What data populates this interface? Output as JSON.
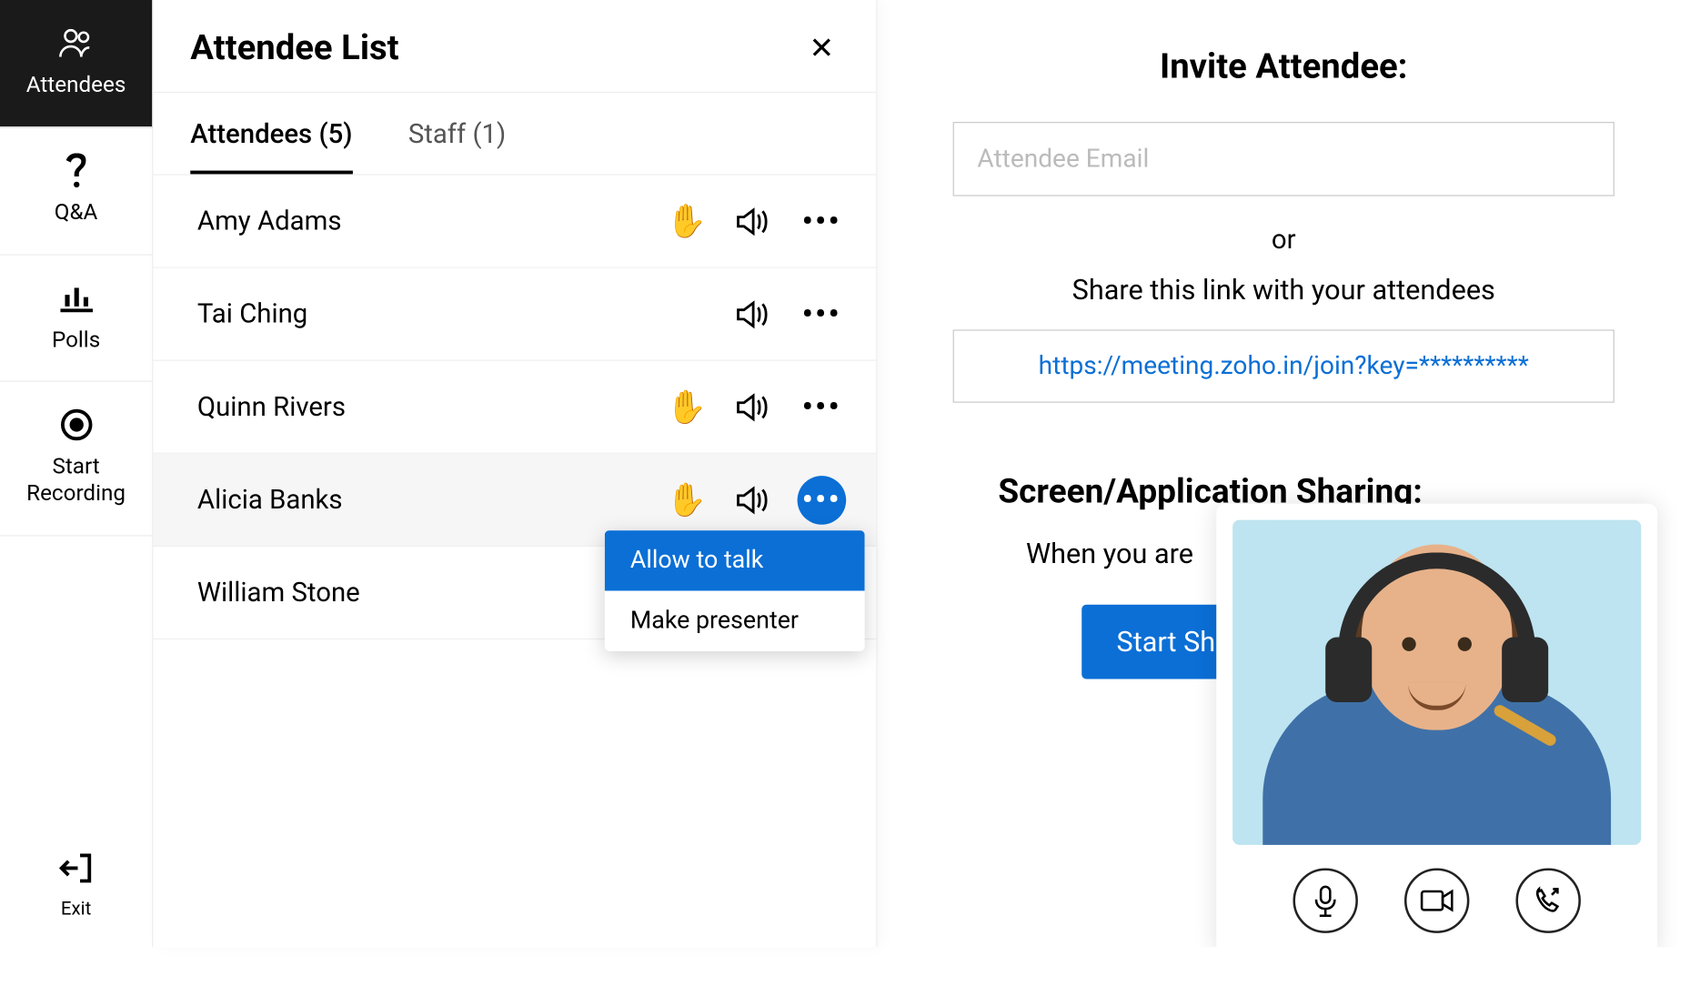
{
  "sidebar": {
    "attendees_label": "Attendees",
    "qa_label": "Q&A",
    "polls_label": "Polls",
    "recording_label": "Start Recording",
    "exit_label": "Exit"
  },
  "panel": {
    "title": "Attendee List",
    "tabs": {
      "attendees_label": "Attendees (5)",
      "staff_label": "Staff (1)"
    },
    "attendees": [
      {
        "name": "Amy Adams",
        "hand_raised": true,
        "menu_open": false
      },
      {
        "name": "Tai Ching",
        "hand_raised": false,
        "menu_open": false
      },
      {
        "name": "Quinn Rivers",
        "hand_raised": true,
        "menu_open": false
      },
      {
        "name": "Alicia Banks",
        "hand_raised": true,
        "menu_open": true
      },
      {
        "name": "William Stone",
        "hand_raised": false,
        "menu_open": false,
        "no_actions": true
      }
    ],
    "menu": {
      "allow_talk": "Allow to talk",
      "make_presenter": "Make presenter"
    }
  },
  "main": {
    "invite_title": "Invite Attendee:",
    "email_placeholder": "Attendee Email",
    "or_text": "or",
    "share_text": "Share this link with your attendees",
    "share_link": "https://meeting.zoho.in/join?key=**********",
    "sharing_title": "Screen/Application Sharing:",
    "sharing_sub": "When you are",
    "start_share_btn": "Start Sh"
  }
}
